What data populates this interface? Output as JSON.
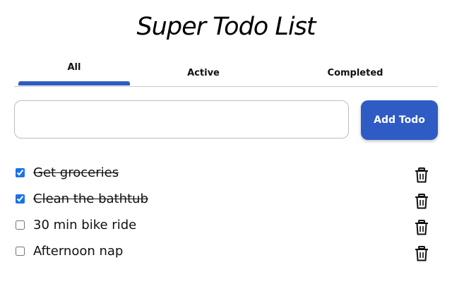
{
  "app": {
    "title": "Super Todo List"
  },
  "tabs": [
    {
      "label": "All",
      "selected": true
    },
    {
      "label": "Active",
      "selected": false
    },
    {
      "label": "Completed",
      "selected": false
    }
  ],
  "new_todo": {
    "value": "",
    "placeholder": "",
    "add_label": "Add Todo"
  },
  "todos": [
    {
      "text": "Get groceries",
      "completed": true,
      "delete_icon": "trash-icon"
    },
    {
      "text": "Clean the bathtub",
      "completed": true,
      "delete_icon": "trash-icon"
    },
    {
      "text": "30 min bike ride",
      "completed": false,
      "delete_icon": "trash-icon"
    },
    {
      "text": "Afternoon nap",
      "completed": false,
      "delete_icon": "trash-icon"
    }
  ],
  "colors": {
    "accent": "#2f5bc4",
    "checkbox": "#1a73e8",
    "divider": "#c8c8c8"
  }
}
